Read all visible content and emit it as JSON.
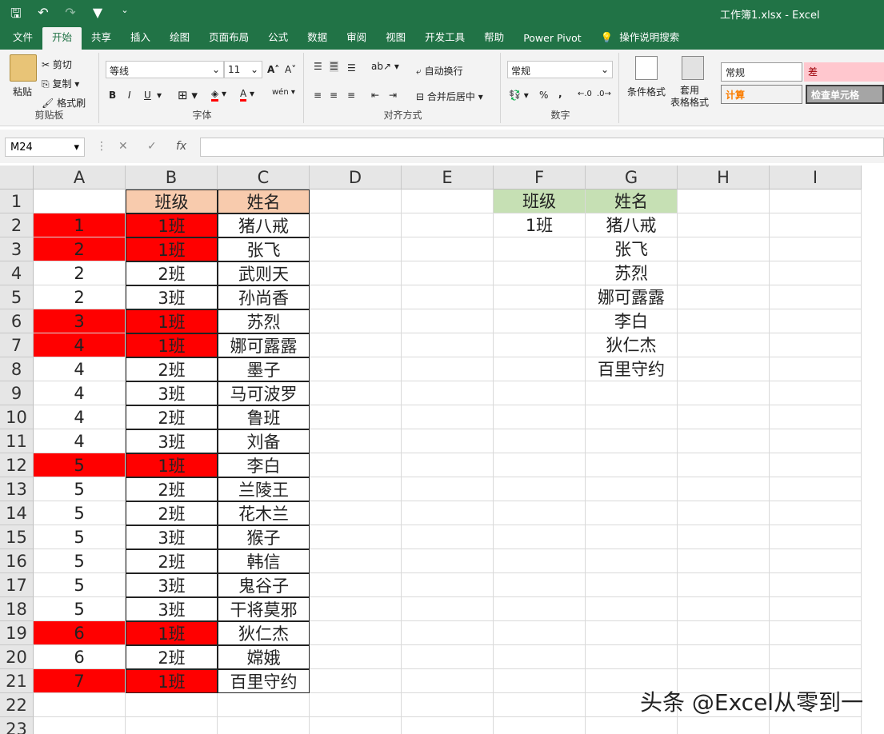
{
  "app": {
    "title": "工作簿1.xlsx  -  Excel",
    "qat_icons": [
      "save-icon",
      "undo-icon",
      "redo-icon",
      "filter-icon",
      "customize-icon"
    ]
  },
  "tabs": [
    "文件",
    "开始",
    "共享",
    "插入",
    "绘图",
    "页面布局",
    "公式",
    "数据",
    "审阅",
    "视图",
    "开发工具",
    "帮助",
    "Power Pivot",
    "操作说明搜索"
  ],
  "active_tab": "开始",
  "ribbon": {
    "clipboard": {
      "paste": "粘贴",
      "cut": "剪切",
      "copy": "复制",
      "format_painter": "格式刷",
      "label": "剪贴板"
    },
    "font": {
      "font_name": "等线",
      "font_size": "11",
      "bold": "B",
      "italic": "I",
      "underline": "U",
      "label": "字体",
      "grow": "A",
      "shrink": "A",
      "phonetic": "wén"
    },
    "alignment": {
      "wrap": "自动换行",
      "merge": "合并后居中",
      "label": "对齐方式"
    },
    "number": {
      "format": "常规",
      "percent": "%",
      "comma": ",",
      "label": "数字"
    },
    "styles": {
      "conditional": "条件格式",
      "table": "套用\n表格格式",
      "normal": "常规",
      "bad": "差",
      "calc": "计算",
      "check": "检查单元格"
    }
  },
  "formula_bar": {
    "name_box": "M24",
    "formula": "",
    "fx": "fx"
  },
  "columns": [
    "A",
    "B",
    "C",
    "D",
    "E",
    "F",
    "G",
    "H",
    "I"
  ],
  "rows": [
    "1",
    "2",
    "3",
    "4",
    "5",
    "6",
    "7",
    "8",
    "9",
    "10",
    "11",
    "12",
    "13",
    "14",
    "15",
    "16",
    "17",
    "18",
    "19",
    "20",
    "21",
    "22",
    "23"
  ],
  "table_left": {
    "headers": [
      "",
      "班级",
      "姓名"
    ],
    "rows": [
      [
        "1",
        "1班",
        "猪八戒"
      ],
      [
        "2",
        "1班",
        "张飞"
      ],
      [
        "2",
        "2班",
        "武则天"
      ],
      [
        "2",
        "3班",
        "孙尚香"
      ],
      [
        "3",
        "1班",
        "苏烈"
      ],
      [
        "4",
        "1班",
        "娜可露露"
      ],
      [
        "4",
        "2班",
        "墨子"
      ],
      [
        "4",
        "3班",
        "马可波罗"
      ],
      [
        "4",
        "2班",
        "鲁班"
      ],
      [
        "4",
        "3班",
        "刘备"
      ],
      [
        "5",
        "1班",
        "李白"
      ],
      [
        "5",
        "2班",
        "兰陵王"
      ],
      [
        "5",
        "2班",
        "花木兰"
      ],
      [
        "5",
        "3班",
        "猴子"
      ],
      [
        "5",
        "2班",
        "韩信"
      ],
      [
        "5",
        "3班",
        "鬼谷子"
      ],
      [
        "5",
        "3班",
        "干将莫邪"
      ],
      [
        "6",
        "1班",
        "狄仁杰"
      ],
      [
        "6",
        "2班",
        "嫦娥"
      ],
      [
        "7",
        "1班",
        "百里守约"
      ]
    ],
    "highlight_rows": [
      0,
      1,
      4,
      5,
      10,
      17,
      19
    ],
    "highlight_color": "#ff0000"
  },
  "table_right": {
    "headers": [
      "班级",
      "姓名"
    ],
    "class": "1班",
    "names": [
      "猪八戒",
      "张飞",
      "苏烈",
      "娜可露露",
      "李白",
      "狄仁杰",
      "百里守约"
    ],
    "header_color": "#c6e0b4"
  },
  "watermark": "头条 @Excel从零到一"
}
